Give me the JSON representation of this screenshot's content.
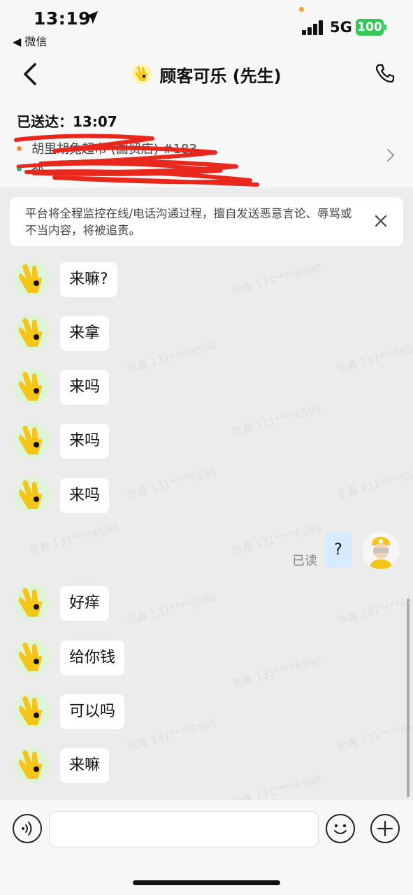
{
  "status_bar": {
    "time": "13:19",
    "back_app": "◀ 微信",
    "network": "5G",
    "battery": "100"
  },
  "nav": {
    "title": "顾客可乐 (先生)"
  },
  "order": {
    "delivered_label": "已送达：13:07",
    "store_name": "胡里胡兔超市 (国贸店) #183",
    "store_address": "都..."
  },
  "notice": {
    "text": "平台将全程监控在线/电话沟通过程，擅自发送恶意言论、辱骂或不当内容，将被追责。"
  },
  "messages": [
    {
      "text": "来嘛?"
    },
    {
      "text": "来拿"
    },
    {
      "text": "来吗"
    },
    {
      "text": "来吗"
    },
    {
      "text": "来吗"
    },
    {
      "text": "好痒"
    },
    {
      "text": "给你钱"
    },
    {
      "text": "可以吗"
    },
    {
      "text": "来嘛"
    }
  ],
  "my_message": {
    "text": "?",
    "read_label": "已读"
  },
  "watermark": {
    "name": "张鑫",
    "phone": "131****6598"
  },
  "input": {
    "placeholder": ""
  },
  "colors": {
    "page_bg": "#ececec",
    "header_bg": "#f7f7f7",
    "my_bubble": "#d8ebfd",
    "battery": "#34c759",
    "store_dot": "#f08a3c",
    "address_dot": "#2eb872",
    "scribble": "#e8281c"
  },
  "icons": {
    "location": "location-arrow-icon",
    "back": "chevron-left-icon",
    "phone": "phone-icon",
    "close": "close-icon",
    "voice": "voice-icon",
    "emoji": "emoji-icon",
    "plus": "plus-icon"
  }
}
